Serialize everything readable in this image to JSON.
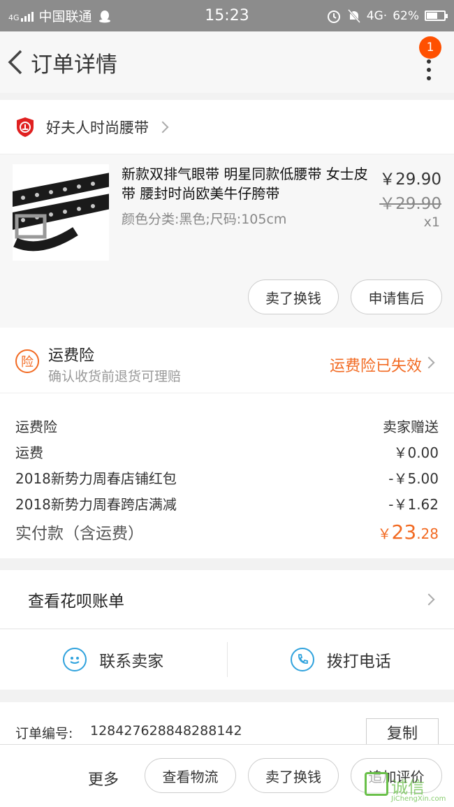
{
  "status_bar": {
    "network": "4G",
    "carrier": "中国联通",
    "time": "15:23",
    "network_right": "4G·",
    "battery": "62%",
    "battery_level": 0.62
  },
  "nav": {
    "title": "订单详情",
    "badge_count": "1"
  },
  "store": {
    "name": "好夫人时尚腰带",
    "icon": "shop-badge-icon"
  },
  "product": {
    "title": "新款双排气眼带 明星同款低腰带 女士皮带 腰封时尚欧美牛仔胯带",
    "spec": "颜色分类:黑色;尺码:105cm",
    "price": "￥29.90",
    "original_price": "￥29.90",
    "quantity": "x1",
    "buttons": [
      "卖了换钱",
      "申请售后"
    ]
  },
  "insurance": {
    "icon_char": "险",
    "title": "运费险",
    "subtitle": "确认收货前退货可理赔",
    "status": "运费险已失效"
  },
  "fees": [
    {
      "label": "运费险",
      "value": "卖家赠送"
    },
    {
      "label": "运费",
      "value": "￥0.00"
    },
    {
      "label": "2018新势力周春店铺红包",
      "value": "-￥5.00"
    },
    {
      "label": "2018新势力周春跨店满减",
      "value": "-￥1.62"
    }
  ],
  "total": {
    "label": "实付款（含运费）",
    "currency": "￥",
    "integer": "23",
    "decimal": ".28"
  },
  "huabei": {
    "label": "查看花呗账单"
  },
  "contact": {
    "seller": "联系卖家",
    "phone": "拨打电话"
  },
  "order": {
    "label": "订单编号:",
    "number": "128427628848288142",
    "copy": "复制"
  },
  "bottom_bar": {
    "more": "更多",
    "buttons": [
      "查看物流",
      "卖了换钱",
      "追加评价"
    ]
  },
  "watermark": {
    "text": "诚信",
    "sub": "JiChengXin.com"
  },
  "colors": {
    "accent": "#f26a22",
    "badge": "#ff5000",
    "contact_icon": "#2fa2dd",
    "status_bar": "#8c8c8c",
    "watermark": "#6ac04a"
  }
}
